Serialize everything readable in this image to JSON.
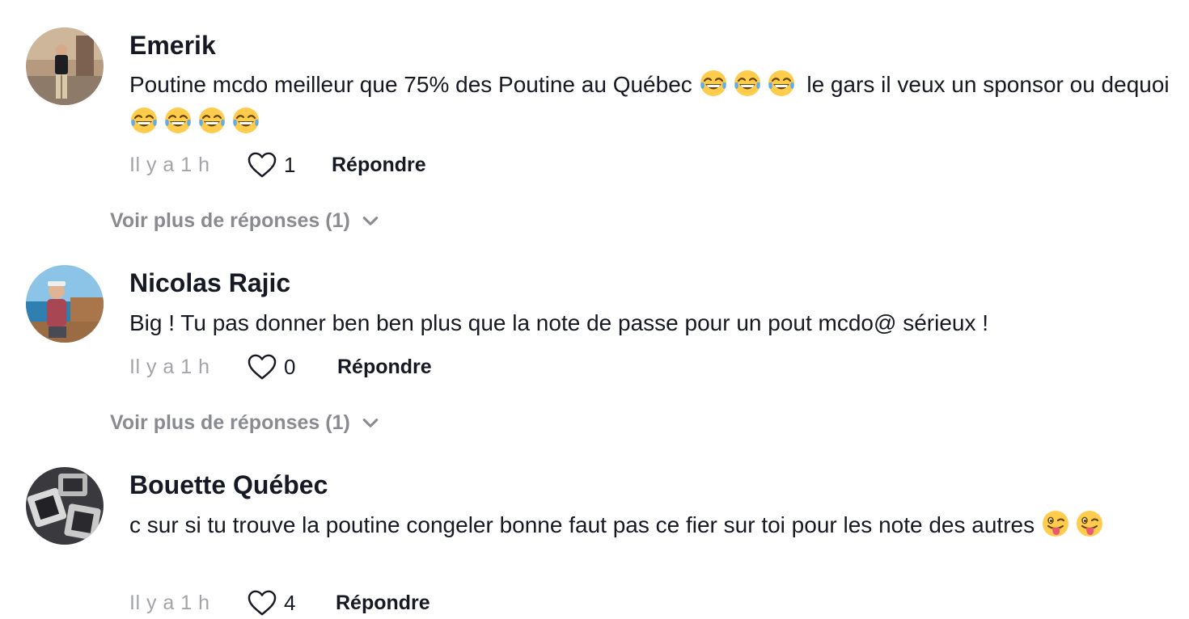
{
  "comments": [
    {
      "username": "Emerik",
      "text_part1": "Poutine mcdo meilleur que 75% des Poutine au Québec ",
      "text_part2": " le gars il veux un sponsor ou dequoi ",
      "time": "Il y a 1 h",
      "likes": "1",
      "reply_label": "Répondre",
      "more_replies": "Voir plus de réponses (1)"
    },
    {
      "username": "Nicolas Rajic",
      "text": "Big ! Tu pas donner ben ben plus que la note de passe pour un pout mcdo@ sérieux !",
      "time": "Il y a 1 h",
      "likes": "0",
      "reply_label": "Répondre",
      "more_replies": "Voir plus de réponses (1)"
    },
    {
      "username": "Bouette Québec",
      "text": "c sur si tu trouve la poutine congeler bonne faut pas ce fier sur toi pour les note des autres ",
      "time": "Il y a 1 h",
      "likes": "4",
      "reply_label": "Répondre"
    }
  ],
  "icons": {
    "heart": "heart-outline-icon",
    "chevron": "chevron-down-icon",
    "laugh_emoji": "face-with-tears-of-joy-emoji",
    "wink_emoji": "winking-face-with-tongue-emoji"
  },
  "colors": {
    "text": "#161823",
    "muted": "#a3a4a9",
    "more_link": "#8a8b91"
  }
}
